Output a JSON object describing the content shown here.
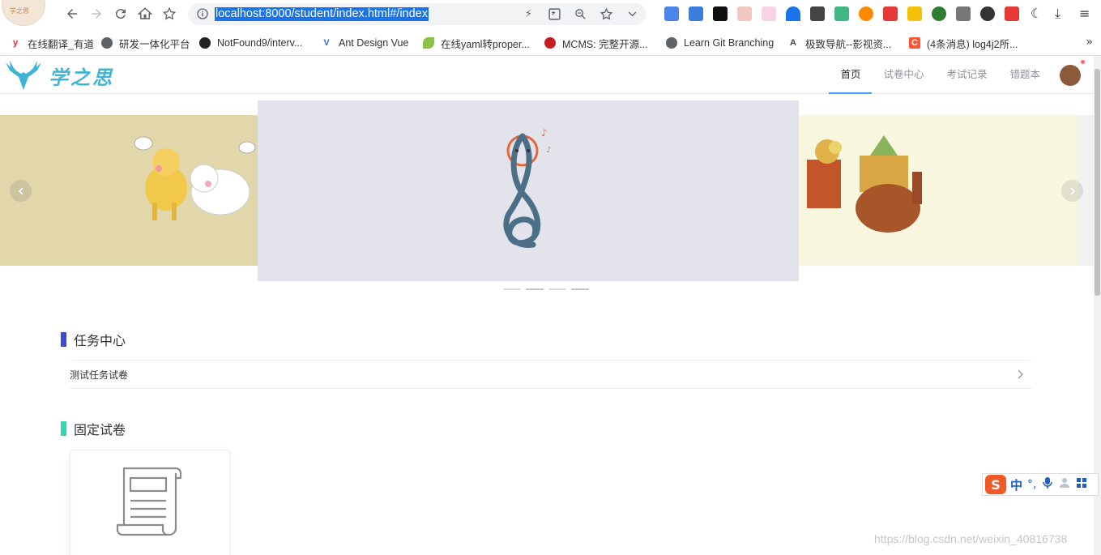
{
  "browser": {
    "tab_logo_text": "学之思",
    "url": "localhost:8000/student/index.html#/index",
    "bookmarks": [
      {
        "label": "在线翻译_有道",
        "icon": "youdao-icon",
        "color": "#e3262b"
      },
      {
        "label": "研发一体化平台",
        "icon": "globe-icon",
        "color": "#5f6368"
      },
      {
        "label": "NotFound9/interv...",
        "icon": "github-icon",
        "color": "#222"
      },
      {
        "label": "Ant Design Vue",
        "icon": "antdv-icon",
        "color": "#2f6fe0"
      },
      {
        "label": "在线yaml转proper...",
        "icon": "leaf-icon",
        "color": "#8bc34a"
      },
      {
        "label": "MCMS: 完整开源...",
        "icon": "gitee-icon",
        "color": "#c71d23"
      },
      {
        "label": "Learn Git Branching",
        "icon": "globe-icon",
        "color": "#5f6368"
      },
      {
        "label": "极致导航--影视资...",
        "icon": "nav-icon",
        "color": "#444"
      },
      {
        "label": "(4条消息) log4j2所...",
        "icon": "csdn-icon",
        "color": "#fc5531"
      }
    ],
    "more": "»"
  },
  "header": {
    "brand_text": "学之思",
    "menu": [
      {
        "label": "首页",
        "active": true
      },
      {
        "label": "试卷中心",
        "active": false
      },
      {
        "label": "考试记录",
        "active": false
      },
      {
        "label": "错题本",
        "active": false
      }
    ]
  },
  "carousel": {
    "slide_count": 4,
    "active_index": 1
  },
  "sections": {
    "task_center": {
      "title": "任务中心",
      "accent": "#3c4ad6",
      "items": [
        {
          "label": "测试任务试卷"
        }
      ]
    },
    "fixed_papers": {
      "title": "固定试卷",
      "accent": "#2fd9b1"
    }
  },
  "ime": {
    "logo": "S",
    "mode": "中",
    "punct": "°,"
  },
  "watermark": "https://blog.csdn.net/weixin_40816738"
}
